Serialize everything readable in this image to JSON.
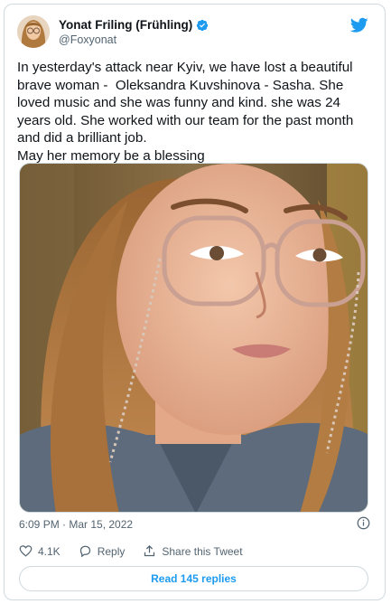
{
  "author": {
    "display_name": "Yonat Friling (Frühling)",
    "handle": "@Foxyonat"
  },
  "tweet": {
    "text": "In yesterday's attack near Kyiv, we have lost a beautiful brave woman -  Oleksandra Kuvshinova - Sasha. She loved music and she was funny and kind. she was 24 years old. She worked with our team for the past month and did a brilliant job.\nMay her memory be a blessing",
    "timestamp": "6:09 PM · Mar 15, 2022"
  },
  "actions": {
    "like_count": "4.1K",
    "reply_label": "Reply",
    "share_label": "Share this Tweet"
  },
  "footer": {
    "read_replies_label": "Read 145 replies"
  },
  "colors": {
    "twitter_blue": "#1d9bf0",
    "text_primary": "#0f1419",
    "text_secondary": "#536471",
    "border": "#cfd9de"
  },
  "icons": [
    "verified-badge-icon",
    "twitter-bird-icon",
    "info-icon",
    "heart-icon",
    "reply-icon",
    "share-icon"
  ]
}
